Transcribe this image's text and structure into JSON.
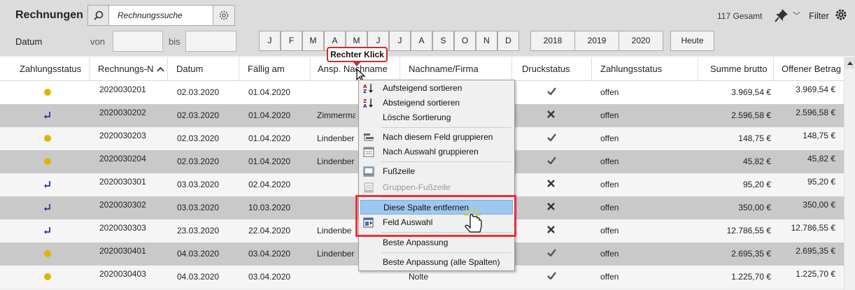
{
  "toolbar": {
    "title": "Rechnungen",
    "search_placeholder": "Rechnungssuche",
    "total": "117 Gesamt",
    "filter_label": "Filter",
    "date_label": "Datum",
    "from_label": "von",
    "to_label": "bis",
    "months": [
      "J",
      "F",
      "M",
      "A",
      "M",
      "J",
      "J",
      "A",
      "S",
      "O",
      "N",
      "D"
    ],
    "years": [
      "2018",
      "2019",
      "2020"
    ],
    "today_label": "Heute"
  },
  "grid": {
    "headers": [
      "Zahlungsstatus",
      "Rechnungs-N",
      "Datum",
      "Fällig am",
      "Ansp. Nachname",
      "Nachname/Firma",
      "Druckstatus",
      "Zahlungsstatus",
      "Summe brutto",
      "Offener Betrag"
    ],
    "rows": [
      {
        "icon": "dot",
        "number": "2020030201",
        "date": "02.03.2020",
        "due": "01.04.2020",
        "contact": "",
        "name": "",
        "print": "check",
        "status": "offen",
        "sum": "3.969,54 €",
        "open": "3.969,54 €"
      },
      {
        "icon": "return",
        "number": "2020030202",
        "date": "02.03.2020",
        "due": "01.04.2020",
        "contact": "Zimmerma",
        "name": "",
        "print": "cross",
        "status": "offen",
        "sum": "2.596,58 €",
        "open": "2.596,58 €"
      },
      {
        "icon": "dot",
        "number": "2020030203",
        "date": "02.03.2020",
        "due": "01.04.2020",
        "contact": "Lindenber",
        "name": "",
        "print": "check",
        "status": "offen",
        "sum": "148,75 €",
        "open": "148,75 €"
      },
      {
        "icon": "dot",
        "number": "2020030204",
        "date": "02.03.2020",
        "due": "01.04.2020",
        "contact": "Lindenber",
        "name": "",
        "print": "check",
        "status": "offen",
        "sum": "45,82 €",
        "open": "45,82 €"
      },
      {
        "icon": "return",
        "number": "2020030301",
        "date": "03.03.2020",
        "due": "02.04.2020",
        "contact": "",
        "name": "",
        "print": "cross",
        "status": "offen",
        "sum": "95,20 €",
        "open": "95,20 €"
      },
      {
        "icon": "return",
        "number": "2020030302",
        "date": "03.03.2020",
        "due": "10.03.2020",
        "contact": "",
        "name": "",
        "print": "cross",
        "status": "offen",
        "sum": "350,00 €",
        "open": "350,00 €"
      },
      {
        "icon": "return",
        "number": "2020030303",
        "date": "23.03.2020",
        "due": "22.04.2020",
        "contact": "Lindenbe",
        "name": "",
        "print": "cross",
        "status": "offen",
        "sum": "12.786,55 €",
        "open": "12.786,55 €"
      },
      {
        "icon": "dot",
        "number": "2020030401",
        "date": "04.03.2020",
        "due": "03.04.2020",
        "contact": "Lindenber",
        "name": "",
        "print": "check",
        "status": "offen",
        "sum": "2.695,35 €",
        "open": "2.695,35 €"
      },
      {
        "icon": "dot",
        "number": "2020030403",
        "date": "04.03.2020",
        "due": "03.04.2020",
        "contact": "",
        "name": "Nolte",
        "print": "check",
        "status": "offen",
        "sum": "1.225,70 €",
        "open": "1.225,70 €"
      }
    ]
  },
  "callout": {
    "text": "Rechter Klick"
  },
  "context_menu": {
    "items": [
      {
        "label": "Aufsteigend sortieren",
        "icon": "sort-ascending-icon"
      },
      {
        "label": "Absteigend sortieren",
        "icon": "sort-descending-icon"
      },
      {
        "label": "Lösche Sortierung",
        "icon": ""
      },
      {
        "label": "Nach diesem Feld gruppieren",
        "icon": "group-by-field-icon"
      },
      {
        "label": "Nach Auswahl gruppieren",
        "icon": "group-by-selection-icon"
      },
      {
        "label": "Fußzeile",
        "icon": "footer-icon"
      },
      {
        "label": "Gruppen-Fußzeile",
        "icon": "group-footer-icon"
      },
      {
        "label": "Diese Spalte entfernen",
        "icon": ""
      },
      {
        "label": "Feld Auswahl",
        "icon": "field-chooser-icon"
      },
      {
        "label": "Beste Anpassung",
        "icon": ""
      },
      {
        "label": "Beste Anpassung (alle Spalten)",
        "icon": ""
      }
    ]
  },
  "colors": {
    "highlight": "#9ec8ef",
    "red_frame": "#e5333a",
    "dot": "#e2b400"
  }
}
